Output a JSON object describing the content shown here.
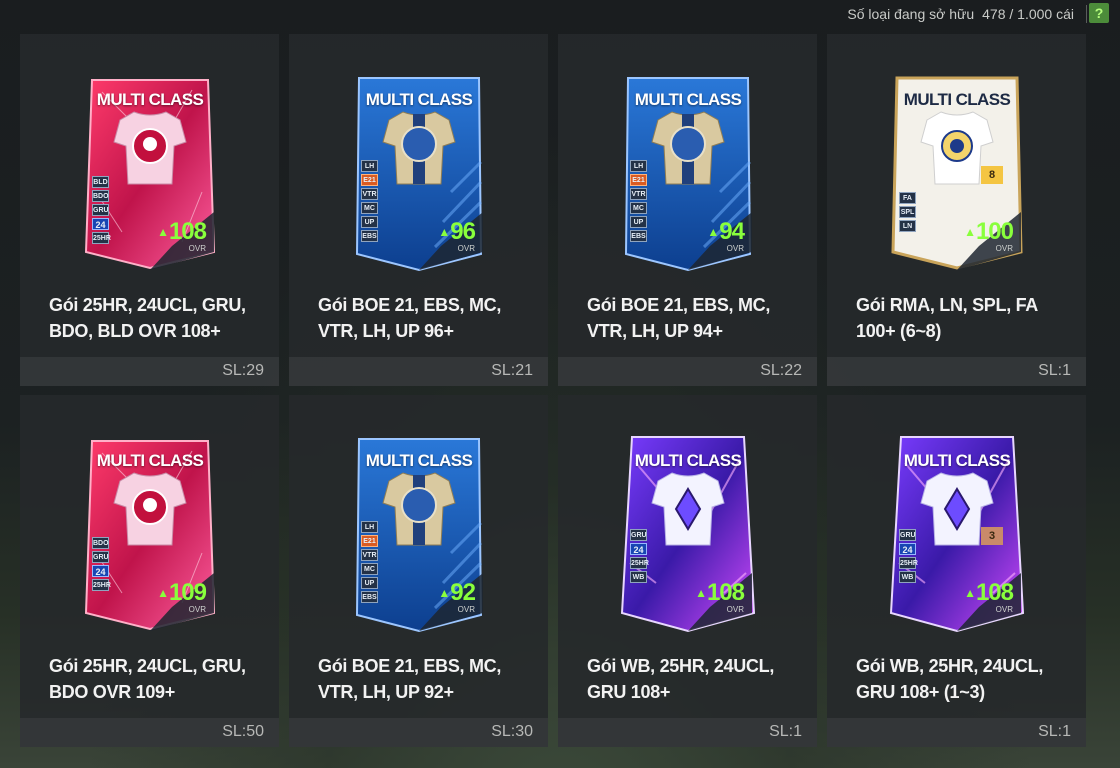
{
  "header": {
    "owned_label": "Số loại đang sở hữu",
    "owned_value": "478 / 1.000 cái",
    "help_label": "?"
  },
  "card_common": {
    "card_title": "MULTI CLASS",
    "ovr_label": "OVR"
  },
  "packs": [
    {
      "title": "Gói 25HR, 24UCL, GRU, BDO, BLD OVR 108+",
      "count": "SL:29",
      "ovr": "108",
      "style": "pink",
      "badges": [
        "BLD",
        "BDO",
        "GRU",
        "24",
        "25HR"
      ],
      "level": ""
    },
    {
      "title": "Gói BOE 21, EBS, MC, VTR, LH, UP 96+",
      "count": "SL:21",
      "ovr": "96",
      "style": "blue",
      "badges": [
        "LH",
        "E21",
        "VTR",
        "MC",
        "UP",
        "EBS"
      ],
      "level": ""
    },
    {
      "title": "Gói BOE 21, EBS, MC, VTR, LH, UP 94+",
      "count": "SL:22",
      "ovr": "94",
      "style": "blue",
      "badges": [
        "LH",
        "E21",
        "VTR",
        "MC",
        "UP",
        "EBS"
      ],
      "level": ""
    },
    {
      "title": "Gói RMA, LN, SPL, FA 100+ (6~8)",
      "count": "SL:1",
      "ovr": "100",
      "style": "white",
      "badges": [
        "FA",
        "SPL",
        "LN"
      ],
      "level": "8"
    },
    {
      "title": "Gói 25HR, 24UCL, GRU, BDO OVR 109+",
      "count": "SL:50",
      "ovr": "109",
      "style": "pink",
      "badges": [
        "BDO",
        "GRU",
        "24",
        "25HR"
      ],
      "level": ""
    },
    {
      "title": "Gói BOE 21, EBS, MC, VTR, LH, UP 92+",
      "count": "SL:30",
      "ovr": "92",
      "style": "blue",
      "badges": [
        "LH",
        "E21",
        "VTR",
        "MC",
        "UP",
        "EBS"
      ],
      "level": ""
    },
    {
      "title": "Gói WB, 25HR, 24UCL, GRU 108+",
      "count": "SL:1",
      "ovr": "108",
      "style": "purple",
      "badges": [
        "GRU",
        "24",
        "25HR",
        "WB"
      ],
      "level": ""
    },
    {
      "title": "Gói WB, 25HR, 24UCL, GRU 108+ (1~3)",
      "count": "SL:1",
      "ovr": "108",
      "style": "purple",
      "badges": [
        "GRU",
        "24",
        "25HR",
        "WB"
      ],
      "level": "3"
    }
  ],
  "colors": {
    "ovr_green": "#89ff3c",
    "help_green": "#4c8c3a",
    "tile_bg": "#26292b"
  }
}
